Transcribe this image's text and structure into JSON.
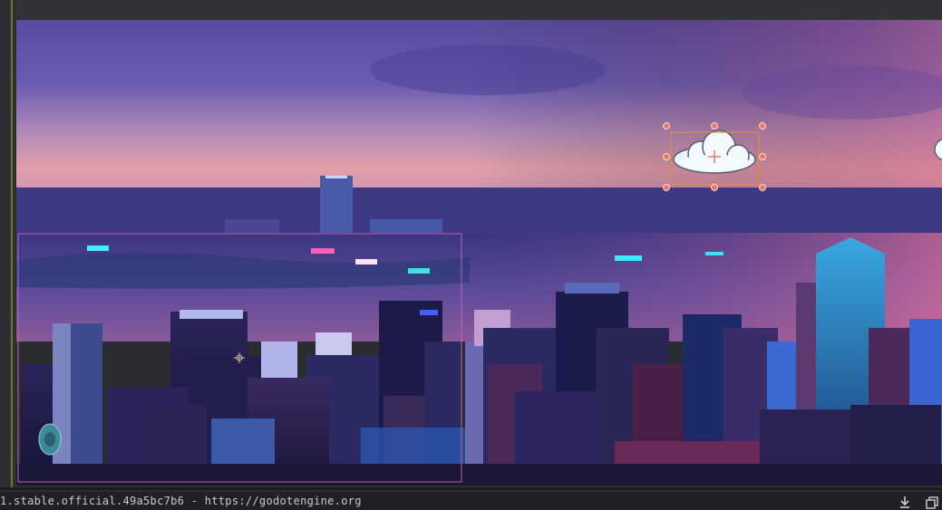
{
  "status_bar": {
    "version_text": "1.stable.official.49a5bc7b6 - https://godotengine.org"
  },
  "icons": {
    "download": "download-icon",
    "copy": "copy-icon",
    "move_gizmo": "move-gizmo-icon"
  },
  "colors": {
    "selection_handle": "#f07860",
    "selection_box": "#e08a4a",
    "camera_rect": "#c060b0",
    "guide_line": "#6e7a2b"
  }
}
